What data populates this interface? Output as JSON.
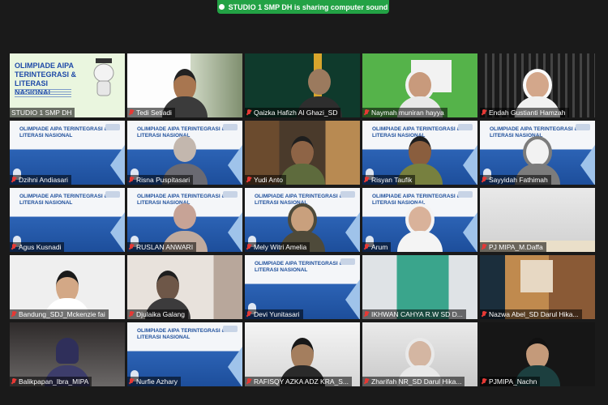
{
  "banner": {
    "text": "STUDIO 1 SMP DH is sharing computer sound"
  },
  "slide_title": "OLIMPIADE AIPA TERINTEGRASI & LITERASI NASIONAL",
  "hero_title": "OLIMPIADE AIPA TERINTEGRASI & LITERASI NASIONAL",
  "tiles": [
    {
      "name": "STUDIO 1 SMP DH"
    },
    {
      "name": "Tedi Setiadi"
    },
    {
      "name": "Qaizka Hafizh Al Ghazi_SD"
    },
    {
      "name": "Naymah muniran hayya"
    },
    {
      "name": "Endah Gustianti Hamzah"
    },
    {
      "name": "Dzihni Andiasari"
    },
    {
      "name": "Risna Puspitasari"
    },
    {
      "name": "Yudi Anto"
    },
    {
      "name": "Risyan Taufik"
    },
    {
      "name": "Sayyidah Fathimah"
    },
    {
      "name": "Agus Kusnadi"
    },
    {
      "name": "RUSLAN ANWARI"
    },
    {
      "name": "Mely Witri Amelia"
    },
    {
      "name": "Arum"
    },
    {
      "name": "PJ MIPA_M.Daffa"
    },
    {
      "name": "Bandung_SDJ_Mckenzie fai"
    },
    {
      "name": "Djulaika Galang"
    },
    {
      "name": "Devi Yunitasari"
    },
    {
      "name": "IKHWAN CAHYA R.W SD D..."
    },
    {
      "name": "Nazwa Abel_SD Darul Hika..."
    },
    {
      "name": "Balikpapan_Ibra_MIPA"
    },
    {
      "name": "Nurfie Azhary"
    },
    {
      "name": "RAFISQY AZKA ADZ KRA_S..."
    },
    {
      "name": "Zharifah NR_SD Darul Hika..."
    },
    {
      "name": "PJMIPA_Nachn"
    }
  ],
  "colors": {
    "banner": "#23a245",
    "active_border": "#b9e55b",
    "mic_off": "#e53935",
    "slide_blue": "#1d4e9b"
  }
}
